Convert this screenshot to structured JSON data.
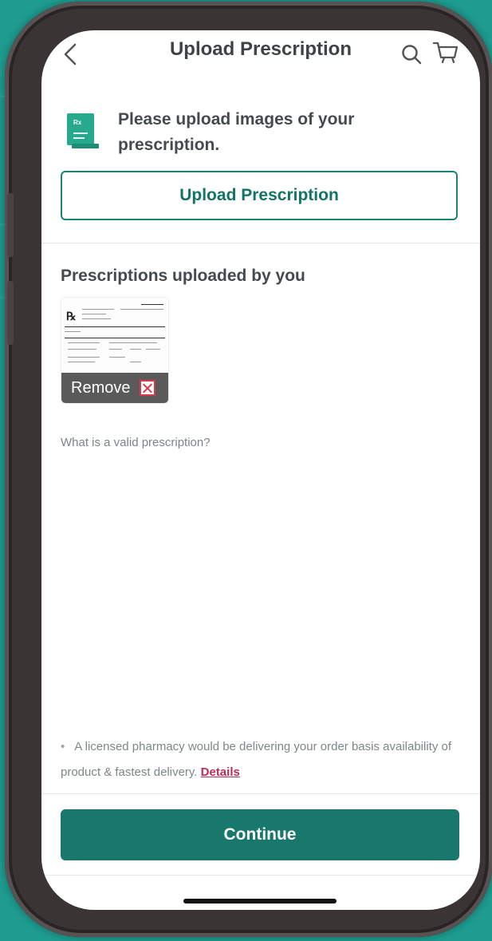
{
  "header": {
    "title": "Upload Prescription",
    "back_icon": "chevron-left-icon",
    "search_icon": "search-icon",
    "cart_icon": "cart-icon"
  },
  "intro": {
    "icon": "prescription-document-icon",
    "text": "Please upload images of your prescription."
  },
  "upload_button": {
    "label": "Upload Prescription"
  },
  "uploaded": {
    "title": "Prescriptions uploaded by you",
    "items": [
      {
        "thumbnail": "prescription-thumbnail",
        "remove_label": "Remove",
        "remove_icon": "close-icon"
      }
    ]
  },
  "valid_link": "What is a valid prescription?",
  "note": {
    "text": "A licensed pharmacy would be delivering your order basis availability of product & fastest delivery.",
    "link": "Details"
  },
  "continue_button": {
    "label": "Continue"
  },
  "colors": {
    "primary": "#18786c",
    "background": "#1e9c8f",
    "link_accent": "#b82f56"
  }
}
